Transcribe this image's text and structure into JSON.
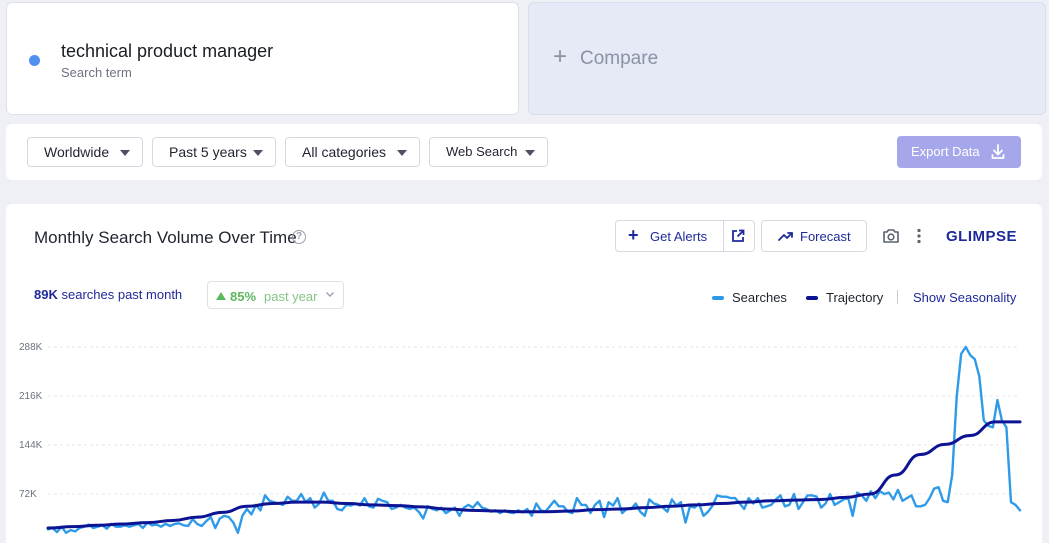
{
  "search_term": {
    "name": "technical product manager",
    "sub": "Search term",
    "dot_color": "#4f8ff0"
  },
  "compare": {
    "label": "Compare"
  },
  "filters": {
    "location": "Worldwide",
    "time_range": "Past 5 years",
    "category": "All categories",
    "source": "Web Search",
    "export_label": "Export Data"
  },
  "chart_panel": {
    "title": "Monthly Search Volume Over Time",
    "get_alerts": "Get Alerts",
    "forecast": "Forecast",
    "brand": "GLIMPSE",
    "volume_value": "89K",
    "volume_text": "searches past month",
    "growth_pct": "85%",
    "growth_text": "past year",
    "legend_searches": "Searches",
    "legend_trajectory": "Trajectory",
    "show_seasonality": "Show Seasonality"
  },
  "colors": {
    "searches": "#2f9be8",
    "trajectory": "#0d1494",
    "accent": "#1f2a9a",
    "export_bg": "#a6a7ea",
    "growth": "#5cb85c"
  },
  "chart_data": {
    "type": "line",
    "yticks": [
      "288K",
      "216K",
      "144K",
      "72K"
    ],
    "ytick_values": [
      288000,
      216000,
      144000,
      72000
    ],
    "ylim": [
      0,
      300000
    ],
    "grid": true,
    "legend": "top-right",
    "series": [
      {
        "name": "Searches",
        "values": [
          20000,
          22000,
          16000,
          24000,
          15000,
          19000,
          17000,
          22000,
          24000,
          27000,
          22000,
          24000,
          26000,
          21000,
          28000,
          24000,
          24000,
          26000,
          24000,
          26000,
          28000,
          22000,
          30000,
          26000,
          27000,
          24000,
          28000,
          25000,
          28000,
          29000,
          26000,
          25000,
          35000,
          28000,
          25000,
          32000,
          38000,
          22000,
          36000,
          40000,
          38000,
          30000,
          15000,
          40000,
          50000,
          42000,
          56000,
          48000,
          70000,
          62000,
          60000,
          58000,
          56000,
          68000,
          62000,
          62000,
          72000,
          60000,
          66000,
          52000,
          58000,
          74000,
          62000,
          62000,
          50000,
          48000,
          56000,
          55000,
          58000,
          55000,
          66000,
          54000,
          52000,
          65000,
          62000,
          60000,
          50000,
          52000,
          56000,
          52000,
          50000,
          52000,
          46000,
          36000,
          54000,
          50000,
          48000,
          52000,
          44000,
          48000,
          52000,
          40000,
          52000,
          56000,
          52000,
          60000,
          52000,
          50000,
          46000,
          48000,
          44000,
          48000,
          45000,
          44000,
          48000,
          45000,
          50000,
          40000,
          58000,
          48000,
          46000,
          54000,
          62000,
          54000,
          54000,
          46000,
          44000,
          66000,
          56000,
          56000,
          44000,
          56000,
          62000,
          38000,
          60000,
          55000,
          66000,
          44000,
          50000,
          50000,
          58000,
          46000,
          40000,
          64000,
          58000,
          56000,
          52000,
          46000,
          64000,
          55000,
          60000,
          30000,
          54000,
          52000,
          58000,
          40000,
          46000,
          55000,
          70000,
          68000,
          68000,
          66000,
          66000,
          58000,
          50000,
          66000,
          58000,
          66000,
          52000,
          54000,
          56000,
          64000,
          70000,
          54000,
          56000,
          72000,
          50000,
          60000,
          70000,
          70000,
          68000,
          52000,
          58000,
          72000,
          56000,
          60000,
          64000,
          66000,
          40000,
          74000,
          70000,
          62000,
          76000,
          66000,
          76000,
          72000,
          74000,
          64000,
          78000,
          62000,
          66000,
          70000,
          54000,
          54000,
          56000,
          66000,
          80000,
          82000,
          62000,
          60000,
          100000,
          215000,
          278000,
          288000,
          276000,
          270000,
          245000,
          180000,
          172000,
          170000,
          210000,
          180000,
          170000,
          60000,
          56000,
          48000
        ]
      },
      {
        "name": "Trajectory",
        "values": [
          22000,
          24000,
          26000,
          28000,
          30000,
          33000,
          38000,
          45000,
          54000,
          58000,
          60000,
          60000,
          58000,
          56000,
          55000,
          53000,
          50000,
          48000,
          47000,
          46000,
          46000,
          47000,
          49000,
          50000,
          52000,
          54000,
          56000,
          58000,
          60000,
          62000,
          63000,
          64000,
          67000,
          72000,
          100000,
          130000,
          145000,
          158000,
          178000,
          178000
        ]
      }
    ]
  }
}
